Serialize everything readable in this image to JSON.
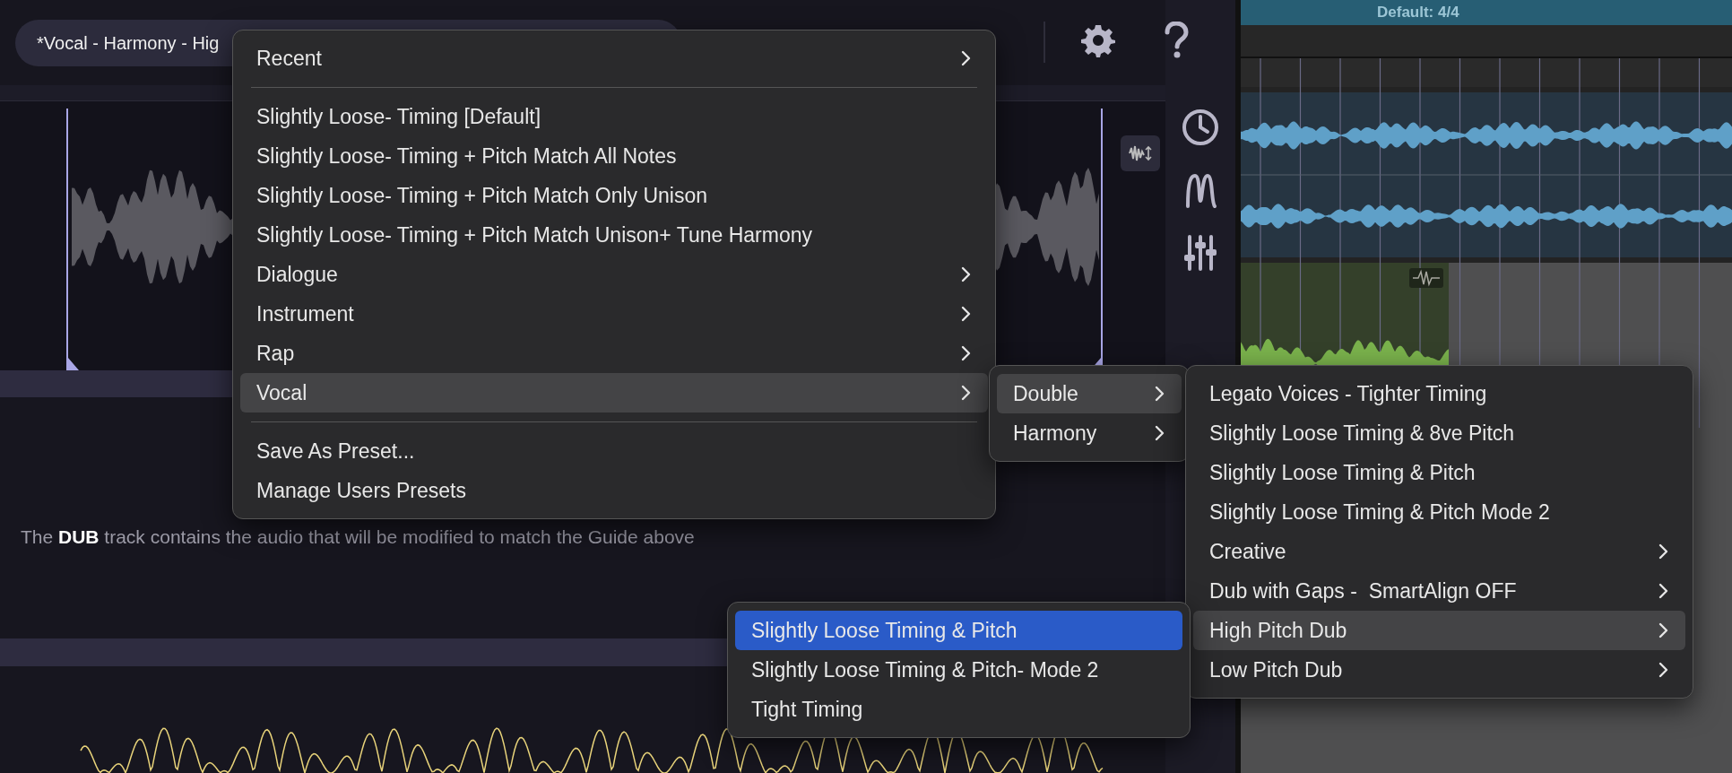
{
  "preset_selector": {
    "value": "*Vocal - Harmony - Hig"
  },
  "daw": {
    "signature_label": "Default: 4/4"
  },
  "description": "The **DUB** track contains the audio that will be modified to match the Guide above",
  "main_menu": {
    "focused": false,
    "items": [
      {
        "kind": "item",
        "label": "Recent",
        "submenu": true,
        "highlighted": false
      },
      {
        "kind": "separator"
      },
      {
        "kind": "item",
        "label": "Slightly Loose- Timing [Default]",
        "submenu": false,
        "highlighted": false
      },
      {
        "kind": "item",
        "label": "Slightly Loose- Timing + Pitch Match All Notes",
        "submenu": false,
        "highlighted": false
      },
      {
        "kind": "item",
        "label": "Slightly Loose- Timing + Pitch Match Only Unison",
        "submenu": false,
        "highlighted": false
      },
      {
        "kind": "item",
        "label": "Slightly Loose- Timing + Pitch Match Unison+ Tune Harmony",
        "submenu": false,
        "highlighted": false
      },
      {
        "kind": "item",
        "label": "Dialogue",
        "submenu": true,
        "highlighted": false
      },
      {
        "kind": "item",
        "label": "Instrument",
        "submenu": true,
        "highlighted": false
      },
      {
        "kind": "item",
        "label": "Rap",
        "submenu": true,
        "highlighted": false
      },
      {
        "kind": "item",
        "label": "Vocal",
        "submenu": true,
        "highlighted": true
      },
      {
        "kind": "separator"
      },
      {
        "kind": "item",
        "label": "Save As Preset...",
        "submenu": false,
        "highlighted": false
      },
      {
        "kind": "item",
        "label": "Manage Users Presets",
        "submenu": false,
        "highlighted": false
      }
    ]
  },
  "vocal_submenu": {
    "focused": false,
    "items": [
      {
        "kind": "item",
        "label": "Double",
        "submenu": true,
        "highlighted": true
      },
      {
        "kind": "item",
        "label": "Harmony",
        "submenu": true,
        "highlighted": false
      }
    ]
  },
  "double_submenu": {
    "focused": false,
    "items": [
      {
        "kind": "item",
        "label": "Legato Voices - Tighter Timing",
        "submenu": false,
        "highlighted": false
      },
      {
        "kind": "item",
        "label": "Slightly Loose Timing & 8ve Pitch",
        "submenu": false,
        "highlighted": false
      },
      {
        "kind": "item",
        "label": "Slightly Loose Timing & Pitch",
        "submenu": false,
        "highlighted": false
      },
      {
        "kind": "item",
        "label": "Slightly Loose Timing & Pitch Mode 2",
        "submenu": false,
        "highlighted": false
      },
      {
        "kind": "item",
        "label": "Creative",
        "submenu": true,
        "highlighted": false
      },
      {
        "kind": "item",
        "label": "Dub with Gaps -  SmartAlign OFF",
        "submenu": true,
        "highlighted": false
      },
      {
        "kind": "item",
        "label": "High Pitch Dub",
        "submenu": true,
        "highlighted": true
      },
      {
        "kind": "item",
        "label": "Low Pitch Dub",
        "submenu": true,
        "highlighted": false
      }
    ]
  },
  "high_pitch_submenu": {
    "focused": true,
    "items": [
      {
        "kind": "item",
        "label": "Slightly Loose Timing & Pitch",
        "submenu": false,
        "highlighted": true
      },
      {
        "kind": "item",
        "label": "Slightly Loose Timing & Pitch- Mode 2",
        "submenu": false,
        "highlighted": false
      },
      {
        "kind": "item",
        "label": "Tight Timing",
        "submenu": false,
        "highlighted": false
      }
    ]
  }
}
